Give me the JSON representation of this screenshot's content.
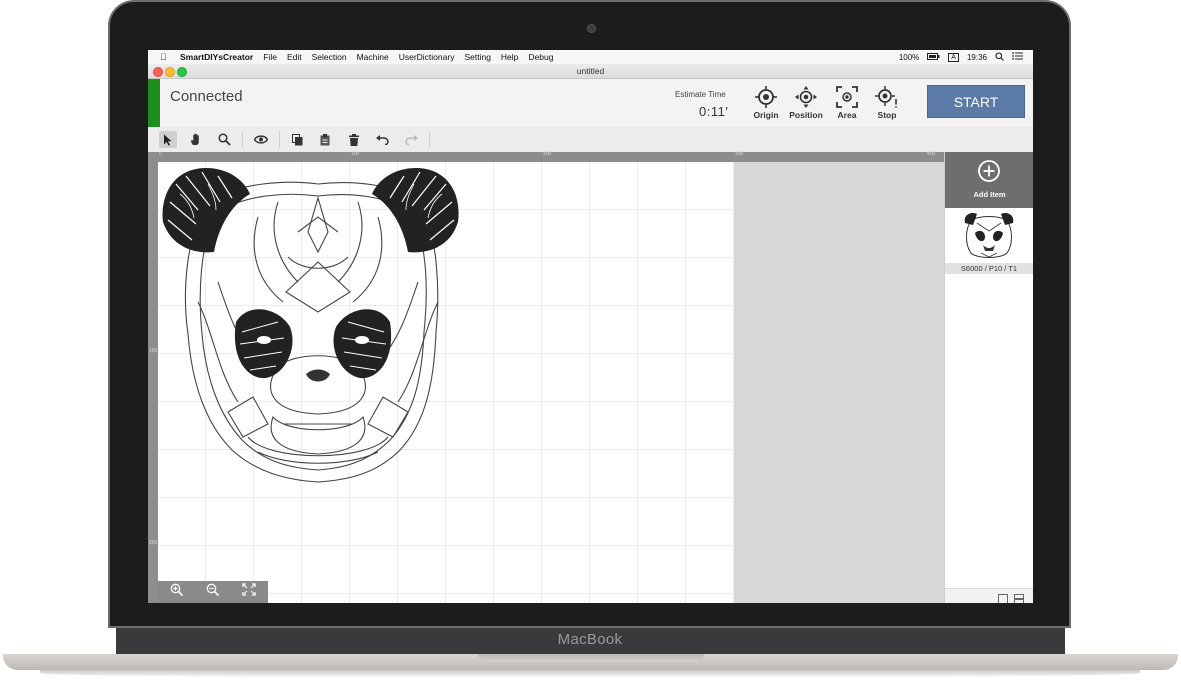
{
  "device": {
    "brand": "MacBook"
  },
  "menubar": {
    "app_name": "SmartDIYsCreator",
    "items": [
      "File",
      "Edit",
      "Selection",
      "Machine",
      "UserDictionary",
      "Setting",
      "Help",
      "Debug"
    ],
    "battery": "100%",
    "input_source": "A",
    "clock": "19:36"
  },
  "window": {
    "title": "untitled"
  },
  "header": {
    "status": "Connected",
    "status_color": "#1e8e1e",
    "estimate_label": "Estimate Time",
    "estimate_value": "0:11′",
    "buttons": {
      "origin": "Origin",
      "position": "Position",
      "area": "Area",
      "stop": "Stop"
    },
    "start_label": "START",
    "start_color": "#5b7aa6"
  },
  "toolbar": {
    "tools": [
      "select-arrow-icon",
      "hand-icon",
      "zoom-icon",
      "eye-icon",
      "copy-icon",
      "paste-icon",
      "trash-icon",
      "undo-icon",
      "redo-icon"
    ]
  },
  "rulers": {
    "horizontal": [
      "0",
      "100",
      "200",
      "300",
      "400"
    ],
    "vertical": [
      "100",
      "200"
    ]
  },
  "zoom_controls": [
    "zoom-in-icon",
    "zoom-out-icon",
    "fit-screen-icon"
  ],
  "panel": {
    "add_item_label": "Add Item",
    "items": [
      {
        "settings": "S6000 / P10 / T1"
      }
    ]
  }
}
